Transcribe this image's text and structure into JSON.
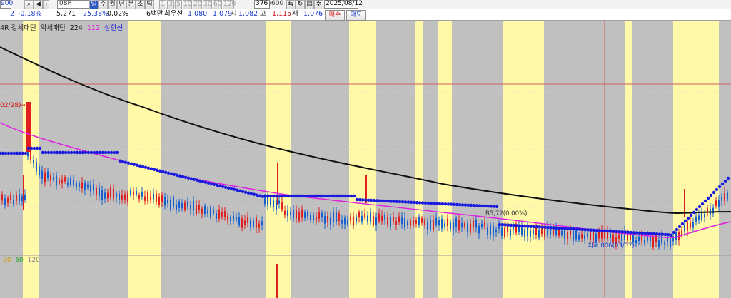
{
  "toolbar": {
    "code": "900",
    "name": "08P",
    "tab_active": "일",
    "periods": [
      "주",
      "월",
      "년",
      "분",
      "초",
      "틱"
    ],
    "intervals": [
      "1",
      "3",
      "5",
      "10",
      "20",
      "30",
      "60",
      "120"
    ],
    "count": "376",
    "total": "/600",
    "date": "2025/08/12"
  },
  "quote": {
    "change": "2",
    "change_pct": "-0.18%",
    "volume": "5,271",
    "ratio": "25.38%",
    "ratio2": "0.02%",
    "info_label": "6백만",
    "tag": "최우선",
    "ask": "1,080",
    "bid": "1,079",
    "open_label": "시",
    "open": "1,082",
    "high_label": "고",
    "high": "1,115",
    "low_label": "저",
    "low": "1,076",
    "buy_btn": "매수",
    "sell_btn": "매도"
  },
  "legend": {
    "left_trim": "4R",
    "strong": "강세패턴",
    "weak": "약세패턴",
    "ma1": "224",
    "ma2": "112",
    "upper": "상한선"
  },
  "annotations": {
    "high_mark": "02/28)",
    "mid_mark": "B5,72(0.00%)",
    "low_mark": "최저 806(03/07)"
  },
  "bottom_legend": {
    "a": "20",
    "b": "60",
    "c": "120"
  },
  "colors": {
    "background": "#c0c0c0",
    "highlight": "#fff9a8",
    "long_ma": "#111111",
    "mid_ma": "#e020e0",
    "blue_line": "#1a1adf",
    "up_candle": "#e02020",
    "down_candle": "#1560d0",
    "crosshair": "#d06060"
  },
  "icons": [
    "search-icon",
    "speaker-icon",
    "arrow-left-icon",
    "arrow-right-icon",
    "refresh-icon",
    "print-icon",
    "settings-icon"
  ],
  "chart_data": {
    "type": "candlestick",
    "title": "",
    "series": [
      {
        "name": "224",
        "style": "black line"
      },
      {
        "name": "112",
        "style": "magenta line"
      },
      {
        "name": "상한선",
        "style": "blue dotted line"
      }
    ]
  }
}
